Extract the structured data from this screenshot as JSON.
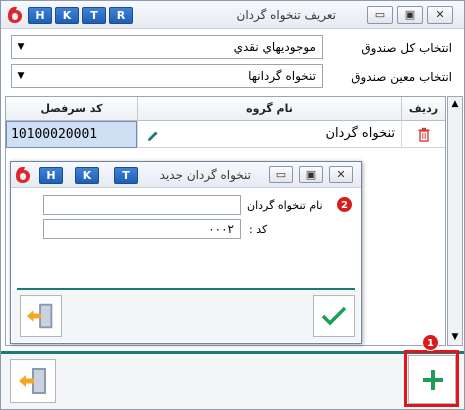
{
  "window": {
    "title": "تعريف تنخواه گردان",
    "hotkeys": [
      "H",
      "K",
      "T",
      "R"
    ],
    "controls": {
      "minimize": "▭",
      "restore": "▣",
      "close": "✕"
    }
  },
  "form": {
    "kol_label": "انتخاب کل صندوق",
    "kol_value": "موجوديهاي نقدي",
    "moein_label": "انتخاب معين صندوق",
    "moein_value": "تنخواه گردانها"
  },
  "grid": {
    "columns": {
      "row": "رديف",
      "group_name": "نام گروه",
      "code": "کد سرفصل"
    },
    "rows": [
      {
        "code": "10100020001",
        "name": "تنخواه گردان"
      }
    ]
  },
  "dialog": {
    "title": "تنخواه گردان جديد",
    "hotkeys": [
      "H",
      "K",
      "T"
    ],
    "name_label": "نام تنخواه گردان",
    "name_value": "",
    "code_label": "کد :",
    "code_value": "۰۰۰۲"
  },
  "annotations": {
    "step1": "1",
    "step2": "2"
  },
  "colors": {
    "accent_teal": "#1d7a72",
    "add_green": "#1f9d55",
    "highlight_red": "#e0161b",
    "title_blue": "#1e5fb5"
  },
  "icons": [
    "app-logo-icon",
    "delete-icon",
    "edit-pencil-icon",
    "exit-door-icon",
    "add-plus-icon",
    "confirm-check-icon"
  ]
}
